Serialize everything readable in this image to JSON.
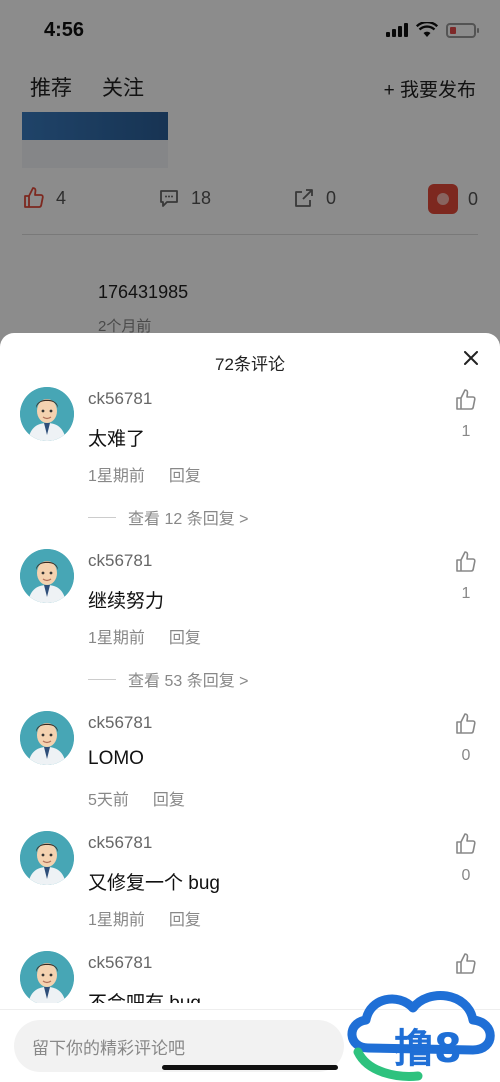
{
  "status": {
    "time": "4:56"
  },
  "top_tabs": [
    "推荐",
    "关注"
  ],
  "publish": "+ 我要发布",
  "post_actions": {
    "likes": "4",
    "comments": "18",
    "shares": "0",
    "favorites": "0"
  },
  "bg_post": {
    "user": "176431985",
    "time": "2个月前"
  },
  "sheet": {
    "title": "72条评论"
  },
  "comments": [
    {
      "user": "ck56781",
      "text": "太难了",
      "time": "1星期前",
      "reply": "回复",
      "likes": "1",
      "more": "查看 12 条回复 >"
    },
    {
      "user": "ck56781",
      "text": "继续努力",
      "time": "1星期前",
      "reply": "回复",
      "likes": "1",
      "more": "查看 53 条回复 >"
    },
    {
      "user": "ck56781",
      "text": "LOMO",
      "time": "5天前",
      "reply": "回复",
      "likes": "0"
    },
    {
      "user": "ck56781",
      "text": "又修复一个 bug",
      "time": "1星期前",
      "reply": "回复",
      "likes": "0"
    },
    {
      "user": "ck56781",
      "text": "不会吧有 bug"
    }
  ],
  "input": {
    "placeholder": "留下你的精彩评论吧"
  },
  "watermark": "撸8"
}
